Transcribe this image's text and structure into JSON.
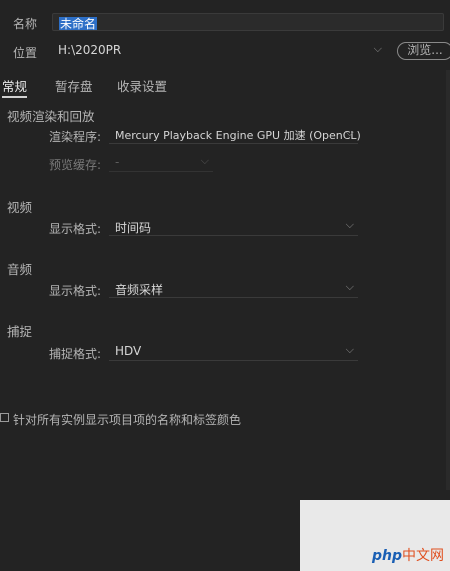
{
  "name_row": {
    "label": "名称",
    "value": "未命名"
  },
  "location_row": {
    "label": "位置",
    "value": "H:\\2020PR",
    "browse_label": "浏览..."
  },
  "tabs": [
    "常规",
    "暂存盘",
    "收录设置"
  ],
  "video_render": {
    "section_title": "视频渲染和回放",
    "renderer_label": "渲染程序:",
    "renderer_value": "Mercury Playback Engine GPU 加速 (OpenCL)",
    "preview_cache_label": "预览缓存:",
    "preview_cache_value": "-"
  },
  "video": {
    "section_title": "视频",
    "display_format_label": "显示格式:",
    "display_format_value": "时间码"
  },
  "audio": {
    "section_title": "音频",
    "display_format_label": "显示格式:",
    "display_format_value": "音频采样"
  },
  "capture": {
    "section_title": "捕捉",
    "capture_format_label": "捕捉格式:",
    "capture_format_value": "HDV"
  },
  "checkbox_label": "针对所有实例显示项目项的名称和标签颜色",
  "watermark": {
    "php": "php",
    "cn": "中文网"
  },
  "colors": {
    "background": "#232323",
    "text": "#b4b4b4",
    "selection": "#2d6fc7"
  }
}
